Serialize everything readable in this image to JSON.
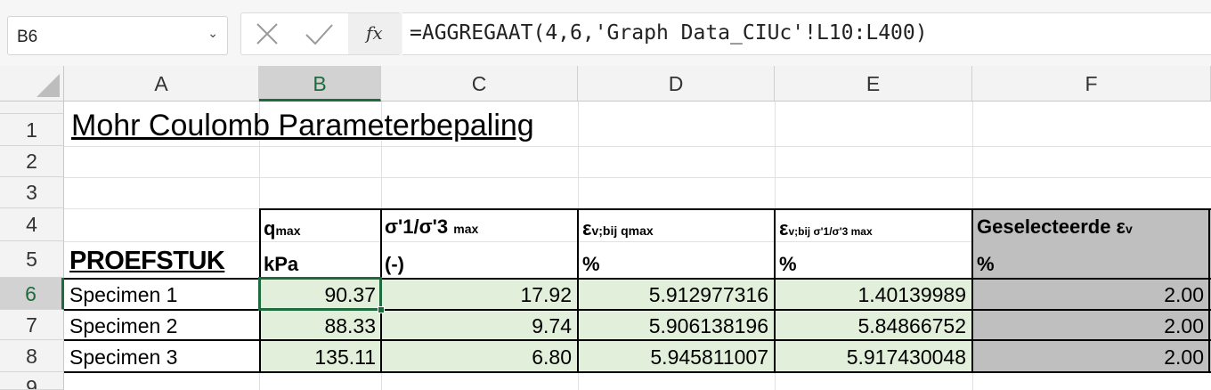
{
  "formula_bar": {
    "name_box": "B6",
    "cancel_icon": "x-icon",
    "enter_icon": "check-icon",
    "fx_label": "fx",
    "formula": "=AGGREGAAT(4,6,'Graph Data_CIUc'!L10:L400)"
  },
  "columns": [
    "A",
    "B",
    "C",
    "D",
    "E",
    "F"
  ],
  "rows": [
    "1",
    "2",
    "3",
    "4",
    "5",
    "6",
    "7",
    "8",
    "9"
  ],
  "title": "Mohr Coulomb Parameterbepaling",
  "proefstuk_label": "PROEFSTUK",
  "headers": {
    "b_main": "q",
    "b_sub": "max",
    "c_main": "σ'1/σ'3",
    "c_sub": "max",
    "d_main": "ε",
    "d_sub": "v;bij qmax",
    "e_main": "ε",
    "e_sub": "v;bij σ'1/σ'3 max",
    "f_main": "Geselecteerde ε",
    "f_sub": "v"
  },
  "units": {
    "b": "kPa",
    "c": "(-)",
    "d": "%",
    "e": "%",
    "f": "%"
  },
  "table": [
    {
      "name": "Specimen 1",
      "qmax": "90.37",
      "ratio": "17.92",
      "ev_q": "5.912977316",
      "ev_r": "1.40139989",
      "ev_sel": "2.00"
    },
    {
      "name": "Specimen 2",
      "qmax": "88.33",
      "ratio": "9.74",
      "ev_q": "5.906138196",
      "ev_r": "5.84866752",
      "ev_sel": "2.00"
    },
    {
      "name": "Specimen 3",
      "qmax": "135.11",
      "ratio": "6.80",
      "ev_q": "5.945811007",
      "ev_r": "5.917430048",
      "ev_sel": "2.00"
    }
  ],
  "colors": {
    "accent": "#1e6b3e",
    "green_fill": "#e2efda",
    "gray_fill": "#bfbfbf"
  }
}
